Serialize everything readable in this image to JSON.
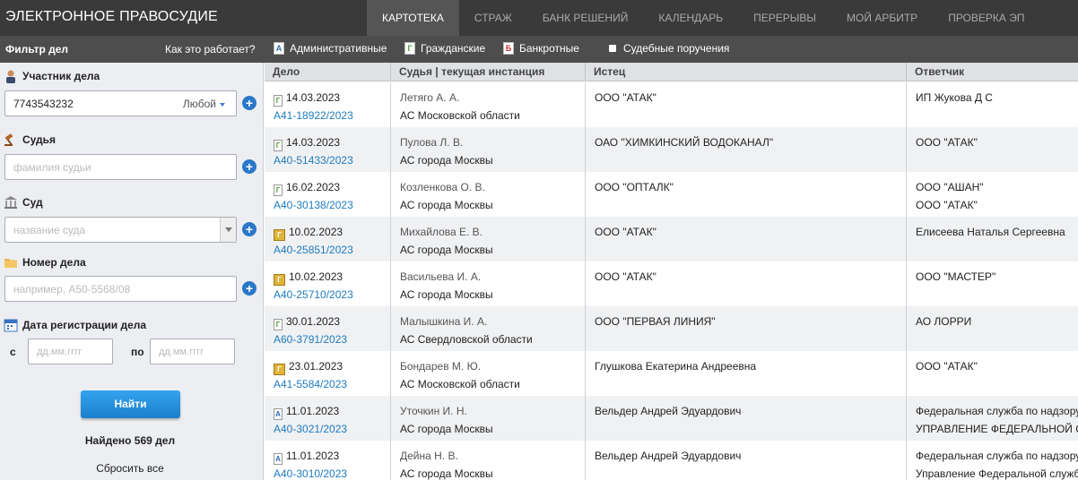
{
  "header": {
    "brand": "ЭЛЕКТРОННОЕ ПРАВОСУДИЕ",
    "tabs": [
      "КАРТОТЕКА",
      "СТРАЖ",
      "БАНК РЕШЕНИЙ",
      "КАЛЕНДАРЬ",
      "ПЕРЕРЫВЫ",
      "МОЙ АРБИТР",
      "ПРОВЕРКА ЭП"
    ],
    "active_tab": "КАРТОТЕКА"
  },
  "subbar": {
    "filter_title": "Фильтр дел",
    "how_it_works": "Как это работает?",
    "case_types": [
      {
        "label": "Административные",
        "icon": "admin-doc-icon",
        "letter": "А"
      },
      {
        "label": "Гражданские",
        "icon": "civil-doc-icon",
        "letter": "Г"
      },
      {
        "label": "Банкротные",
        "icon": "bankrupt-doc-icon",
        "letter": "Б"
      },
      {
        "label": "Судебные поручения",
        "icon": "bullet-icon",
        "letter": ""
      }
    ]
  },
  "sidebar": {
    "participant": {
      "label": "Участник дела",
      "value": "7743543232",
      "role": "Любой"
    },
    "judge": {
      "label": "Судья",
      "placeholder": "фамилия судьи"
    },
    "court": {
      "label": "Суд",
      "placeholder": "название суда"
    },
    "case_number": {
      "label": "Номер дела",
      "placeholder": "например, А50-5568/08"
    },
    "reg_date": {
      "label": "Дата регистрации дела",
      "from_label": "с",
      "to_label": "по",
      "from_placeholder": "дд.мм.гггг",
      "to_placeholder": "дд.мм.гггг"
    },
    "find_button": "Найти",
    "found": "Найдено 569 дел",
    "reset": "Сбросить все"
  },
  "table": {
    "columns": [
      "Дело",
      "Судья | текущая инстанция",
      "Истец",
      "Ответчик"
    ],
    "rows": [
      {
        "icon": "g",
        "date": "14.03.2023",
        "case": "А41-18922/2023",
        "judge": "Летяго А. А.",
        "court": "АС Московской области",
        "plaintiff": [
          "ООО \"АТАК\""
        ],
        "defendant": [
          "ИП Жукова Д С"
        ]
      },
      {
        "icon": "g",
        "date": "14.03.2023",
        "case": "А40-51433/2023",
        "judge": "Пулова Л. В.",
        "court": "АС города Москвы",
        "plaintiff": [
          "ОАО \"ХИМКИНСКИЙ ВОДОКАНАЛ\""
        ],
        "defendant": [
          "ООО \"АТАК\""
        ]
      },
      {
        "icon": "g",
        "date": "16.02.2023",
        "case": "А40-30138/2023",
        "judge": "Козленкова О. В.",
        "court": "АС города Москвы",
        "plaintiff": [
          "ООО \"ОПТАЛК\""
        ],
        "defendant": [
          "ООО \"АШАН\"",
          "ООО \"АТАК\""
        ]
      },
      {
        "icon": "gold",
        "date": "10.02.2023",
        "case": "А40-25851/2023",
        "judge": "Михайлова Е. В.",
        "court": "АС города Москвы",
        "plaintiff": [
          "ООО \"АТАК\""
        ],
        "defendant": [
          "Елисеева Наталья Сергеевна"
        ]
      },
      {
        "icon": "gold",
        "date": "10.02.2023",
        "case": "А40-25710/2023",
        "judge": "Васильева И. А.",
        "court": "АС города Москвы",
        "plaintiff": [
          "ООО \"АТАК\""
        ],
        "defendant": [
          "ООО \"МАСТЕР\""
        ]
      },
      {
        "icon": "g",
        "date": "30.01.2023",
        "case": "А60-3791/2023",
        "judge": "Малышкина И. А.",
        "court": "АС Свердловской области",
        "plaintiff": [
          "ООО \"ПЕРВАЯ ЛИНИЯ\""
        ],
        "defendant": [
          "АО ЛОРРИ"
        ]
      },
      {
        "icon": "gold",
        "date": "23.01.2023",
        "case": "А41-5584/2023",
        "judge": "Бондарев М. Ю.",
        "court": "АС Московской области",
        "plaintiff": [
          "Глушкова Екатерина Андреевна"
        ],
        "defendant": [
          "ООО \"АТАК\""
        ]
      },
      {
        "icon": "a",
        "date": "11.01.2023",
        "case": "А40-3021/2023",
        "judge": "Уточкин И. Н.",
        "court": "АС города Москвы",
        "plaintiff": [
          "Вельдер Андрей Эдуардович"
        ],
        "defendant": [
          "Федеральная служба по надзору",
          "УПРАВЛЕНИЕ ФЕДЕРАЛЬНОЙ С"
        ]
      },
      {
        "icon": "a",
        "date": "11.01.2023",
        "case": "А40-3010/2023",
        "judge": "Дейна Н. В.",
        "court": "АС города Москвы",
        "plaintiff": [
          "Вельдер Андрей Эдуардович"
        ],
        "defendant": [
          "Федеральная служба по надзору",
          "Управление Федеральной служб"
        ]
      }
    ]
  }
}
